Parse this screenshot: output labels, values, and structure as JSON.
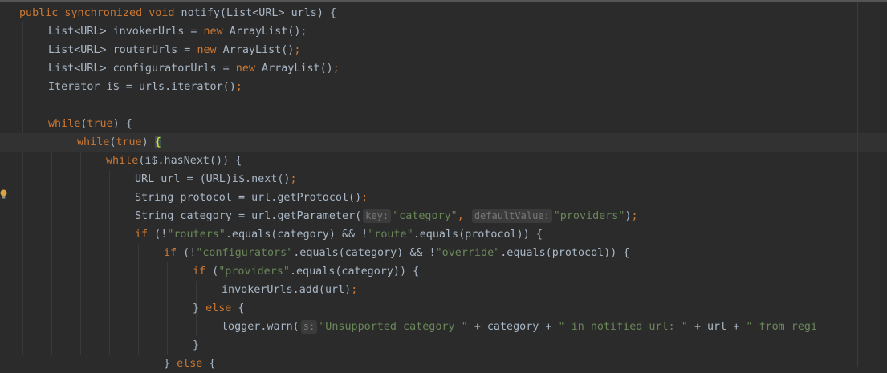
{
  "colors": {
    "background": "#2b2b2b",
    "keyword": "#cc7832",
    "string": "#6a8759",
    "text": "#a9b7c6",
    "hint": "#787878"
  },
  "gutter": {
    "bulb_icon": "lightbulb-icon"
  },
  "lines": [
    {
      "indent": 0,
      "tokens": [
        {
          "t": "kw",
          "v": "public synchronized void"
        },
        {
          "t": "plain",
          "v": " notify(List<URL> urls) {"
        }
      ]
    },
    {
      "indent": 1,
      "tokens": [
        {
          "t": "plain",
          "v": "List<URL> invokerUrls = "
        },
        {
          "t": "kw",
          "v": "new"
        },
        {
          "t": "plain",
          "v": " ArrayList()"
        },
        {
          "t": "kw",
          "v": ";"
        }
      ]
    },
    {
      "indent": 1,
      "tokens": [
        {
          "t": "plain",
          "v": "List<URL> routerUrls = "
        },
        {
          "t": "kw",
          "v": "new"
        },
        {
          "t": "plain",
          "v": " ArrayList()"
        },
        {
          "t": "kw",
          "v": ";"
        }
      ]
    },
    {
      "indent": 1,
      "tokens": [
        {
          "t": "plain",
          "v": "List<URL> configuratorUrls = "
        },
        {
          "t": "kw",
          "v": "new"
        },
        {
          "t": "plain",
          "v": " ArrayList()"
        },
        {
          "t": "kw",
          "v": ";"
        }
      ]
    },
    {
      "indent": 1,
      "tokens": [
        {
          "t": "plain",
          "v": "Iterator i$ = urls.iterator()"
        },
        {
          "t": "kw",
          "v": ";"
        }
      ]
    },
    {
      "indent": 0,
      "tokens": []
    },
    {
      "indent": 1,
      "tokens": [
        {
          "t": "kw",
          "v": "while"
        },
        {
          "t": "plain",
          "v": "("
        },
        {
          "t": "kw",
          "v": "true"
        },
        {
          "t": "plain",
          "v": ") {"
        }
      ]
    },
    {
      "indent": 2,
      "current": true,
      "tokens": [
        {
          "t": "kw",
          "v": "while"
        },
        {
          "t": "plain",
          "v": "("
        },
        {
          "t": "kw",
          "v": "true"
        },
        {
          "t": "plain",
          "v": ") "
        },
        {
          "t": "brace",
          "v": "{"
        }
      ]
    },
    {
      "indent": 3,
      "tokens": [
        {
          "t": "kw",
          "v": "while"
        },
        {
          "t": "plain",
          "v": "(i$.hasNext()) {"
        }
      ]
    },
    {
      "indent": 4,
      "tokens": [
        {
          "t": "plain",
          "v": "URL url = (URL)i$.next()"
        },
        {
          "t": "kw",
          "v": ";"
        }
      ]
    },
    {
      "indent": 4,
      "tokens": [
        {
          "t": "plain",
          "v": "String protocol = url.getProtocol()"
        },
        {
          "t": "kw",
          "v": ";"
        }
      ]
    },
    {
      "indent": 4,
      "tokens": [
        {
          "t": "plain",
          "v": "String category = url.getParameter("
        },
        {
          "t": "hint",
          "v": "key:"
        },
        {
          "t": "str",
          "v": "\"category\""
        },
        {
          "t": "kw",
          "v": ","
        },
        {
          "t": "plain",
          "v": " "
        },
        {
          "t": "hint",
          "v": "defaultValue:"
        },
        {
          "t": "str",
          "v": "\"providers\""
        },
        {
          "t": "plain",
          "v": ")"
        },
        {
          "t": "kw",
          "v": ";"
        }
      ]
    },
    {
      "indent": 4,
      "tokens": [
        {
          "t": "kw",
          "v": "if"
        },
        {
          "t": "plain",
          "v": " (!"
        },
        {
          "t": "str",
          "v": "\"routers\""
        },
        {
          "t": "plain",
          "v": ".equals(category) && !"
        },
        {
          "t": "str",
          "v": "\"route\""
        },
        {
          "t": "plain",
          "v": ".equals(protocol)) {"
        }
      ]
    },
    {
      "indent": 5,
      "tokens": [
        {
          "t": "kw",
          "v": "if"
        },
        {
          "t": "plain",
          "v": " (!"
        },
        {
          "t": "str",
          "v": "\"configurators\""
        },
        {
          "t": "plain",
          "v": ".equals(category) && !"
        },
        {
          "t": "str",
          "v": "\"override\""
        },
        {
          "t": "plain",
          "v": ".equals(protocol)) {"
        }
      ]
    },
    {
      "indent": 6,
      "tokens": [
        {
          "t": "kw",
          "v": "if"
        },
        {
          "t": "plain",
          "v": " ("
        },
        {
          "t": "str",
          "v": "\"providers\""
        },
        {
          "t": "plain",
          "v": ".equals(category)) {"
        }
      ]
    },
    {
      "indent": 7,
      "tokens": [
        {
          "t": "plain",
          "v": "invokerUrls.add(url)"
        },
        {
          "t": "kw",
          "v": ";"
        }
      ]
    },
    {
      "indent": 6,
      "tokens": [
        {
          "t": "plain",
          "v": "} "
        },
        {
          "t": "kw",
          "v": "else"
        },
        {
          "t": "plain",
          "v": " {"
        }
      ]
    },
    {
      "indent": 7,
      "tokens": [
        {
          "t": "plain",
          "v": "logger.warn("
        },
        {
          "t": "hint",
          "v": "s:"
        },
        {
          "t": "str",
          "v": "\"Unsupported category \""
        },
        {
          "t": "plain",
          "v": " + category + "
        },
        {
          "t": "str",
          "v": "\" in notified url: \""
        },
        {
          "t": "plain",
          "v": " + url + "
        },
        {
          "t": "str",
          "v": "\" from regi"
        }
      ]
    },
    {
      "indent": 6,
      "tokens": [
        {
          "t": "plain",
          "v": "}"
        }
      ]
    },
    {
      "indent": 5,
      "tokens": [
        {
          "t": "plain",
          "v": "} "
        },
        {
          "t": "kw",
          "v": "else"
        },
        {
          "t": "plain",
          "v": " {"
        }
      ]
    }
  ]
}
